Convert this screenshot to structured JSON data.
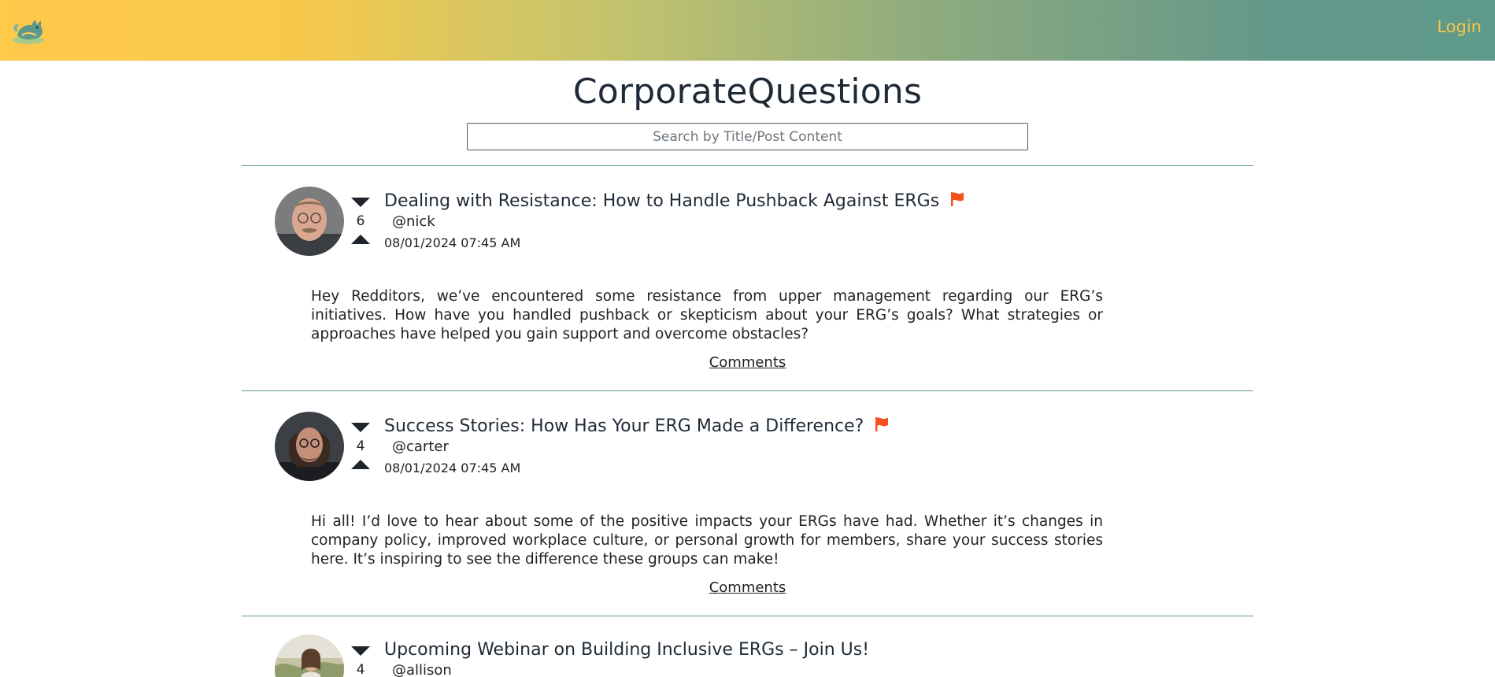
{
  "header": {
    "logo_icon": "fox-logo-icon",
    "login_label": "Login",
    "gradient": [
      "#ffc94a",
      "#5e9a8b"
    ]
  },
  "page": {
    "title": "CorporateQuestions",
    "search_placeholder": "Search by Title/Post Content"
  },
  "posts": [
    {
      "title": "Dealing with Resistance: How to Handle Pushback Against ERGs",
      "flagged": true,
      "votes": "6",
      "user": "@nick",
      "timestamp": "08/01/2024 07:45 AM",
      "body": "Hey Redditors, we’ve encountered some resistance from upper management regarding our ERG’s initiatives. How have you handled pushback or skepticism about your ERG’s goals? What strategies or approaches have helped you gain support and overcome obstacles?",
      "comments_label": "Comments"
    },
    {
      "title": "Success Stories: How Has Your ERG Made a Difference?",
      "flagged": true,
      "votes": "4",
      "user": "@carter",
      "timestamp": "08/01/2024 07:45 AM",
      "body": "Hi all! I’d love to hear about some of the positive impacts your ERGs have had. Whether it’s changes in company policy, improved workplace culture, or personal growth for members, share your success stories here. It’s inspiring to see the difference these groups can make!",
      "comments_label": "Comments"
    },
    {
      "title": "Upcoming Webinar on Building Inclusive ERGs – Join Us!",
      "flagged": false,
      "votes": "4",
      "user": "@allison"
    }
  ],
  "colors": {
    "accent": "#5e9a8b",
    "flag": "#f4511e",
    "login": "#f7c54a"
  }
}
